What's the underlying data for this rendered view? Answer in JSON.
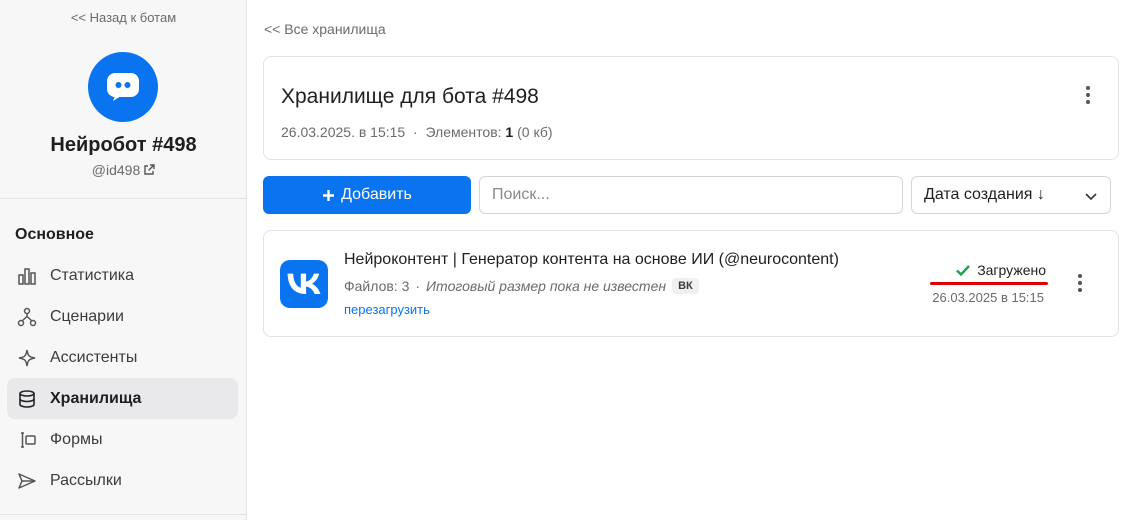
{
  "sidebar": {
    "back_label": "<< Назад к ботам",
    "bot_name": "Нейробот #498",
    "bot_handle": "@id498",
    "section_title": "Основное",
    "items": [
      {
        "label": "Статистика",
        "icon": "bar-chart-icon"
      },
      {
        "label": "Сценарии",
        "icon": "flow-icon"
      },
      {
        "label": "Ассистенты",
        "icon": "sparkle-icon"
      },
      {
        "label": "Хранилища",
        "icon": "database-icon",
        "active": true
      },
      {
        "label": "Формы",
        "icon": "form-icon"
      },
      {
        "label": "Рассылки",
        "icon": "send-icon"
      }
    ]
  },
  "main": {
    "breadcrumb": "<< Все хранилища",
    "storage": {
      "title": "Хранилище для бота #498",
      "date": "26.03.2025. в 15:15",
      "separator": "·",
      "elements_label": "Элементов:",
      "elements_count": "1",
      "elements_size": "(0 кб)"
    },
    "toolbar": {
      "add_label": "Добавить",
      "search_placeholder": "Поиск...",
      "sort_label": "Дата создания ↓"
    },
    "items": [
      {
        "title": "Нейроконтент | Генератор контента на основе ИИ (@neurocontent)",
        "files": "Файлов: 3",
        "separator": "·",
        "size_note": "Итоговый размер пока не известен",
        "badge": "ВК",
        "reload_label": "перезагрузить",
        "status": "Загружено",
        "status_date": "26.03.2025 в 15:15"
      }
    ]
  },
  "colors": {
    "accent": "#0a74f0",
    "success": "#1aa34a",
    "underline": "#e00000"
  }
}
